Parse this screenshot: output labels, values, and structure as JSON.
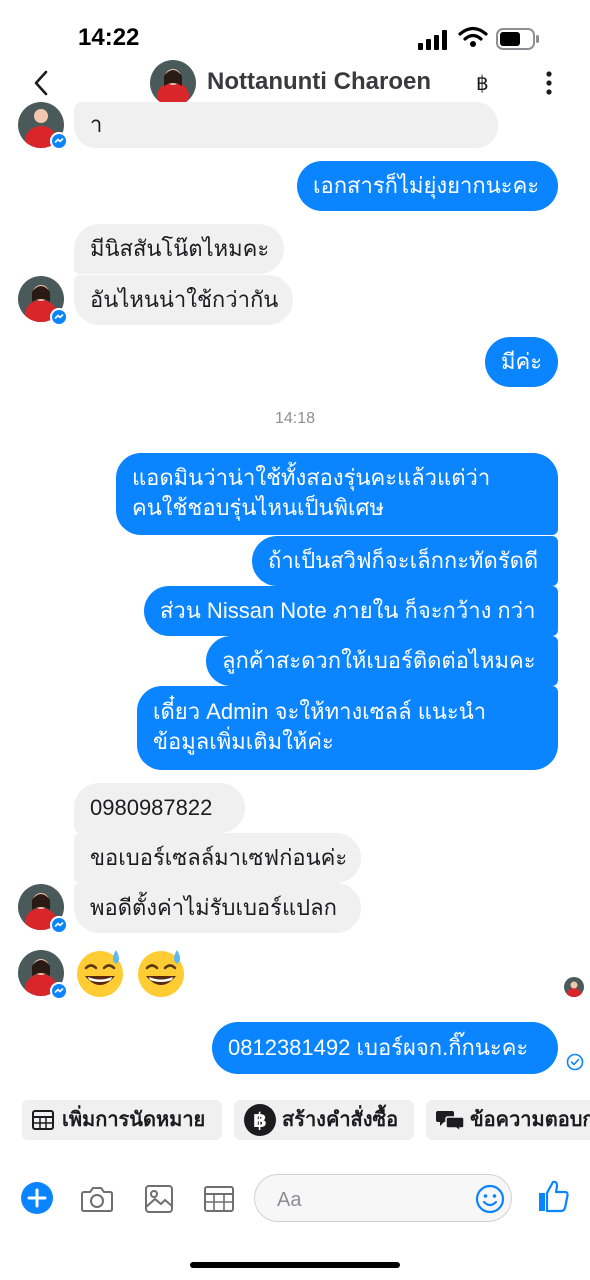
{
  "status_bar": {
    "time": "14:22"
  },
  "header": {
    "contact_name": "Nottanunti Charoen",
    "baht_symbol": "฿"
  },
  "messages": {
    "m1": "า",
    "m2": "เอกสารก็ไม่ยุ่งยากนะคะ",
    "m3": "มีนิสสันโน๊ตไหมคะ",
    "m4": "อันไหนน่าใช้กว่ากัน",
    "m5": "มีค่ะ",
    "timestamp": "14:18",
    "m6": "แอดมินว่าน่าใช้ทั้งสองรุ่นคะแล้วแต่ว่าคนใช้ชอบรุ่นไหนเป็นพิเศษ",
    "m7": "ถ้าเป็นสวิฟก็จะเล็กกะทัดรัดดี",
    "m8": "ส่วน Nissan Note ภายใน ก็จะกว้าง กว่า",
    "m9": "ลูกค้าสะดวกให้เบอร์ติดต่อไหมคะ",
    "m10": "เดี๋ยว Admin จะให้ทางเซลล์ แนะนำข้อมูลเพิ่มเติมให้ค่ะ",
    "m11": "0980987822",
    "m12": "ขอเบอร์เซลล์มาเซฟก่อนค่ะ",
    "m13": "พอดีตั้งค่าไม่รับเบอร์แปลก",
    "m14": "0812381492 เบอร์ผจก.กิ๊กนะคะ"
  },
  "quick_replies": [
    {
      "label": "เพิ่มการนัดหมาย",
      "icon": "calendar-icon"
    },
    {
      "label": "สร้างคำสั่งซื้อ",
      "icon": "baht-icon"
    },
    {
      "label": "ข้อความตอบก",
      "icon": "chat-bubbles-icon"
    }
  ],
  "composer": {
    "placeholder": "Aa"
  },
  "colors": {
    "outgoing": "#0a84ff",
    "incoming": "#f0f0f0",
    "accent": "#0a84ff"
  }
}
